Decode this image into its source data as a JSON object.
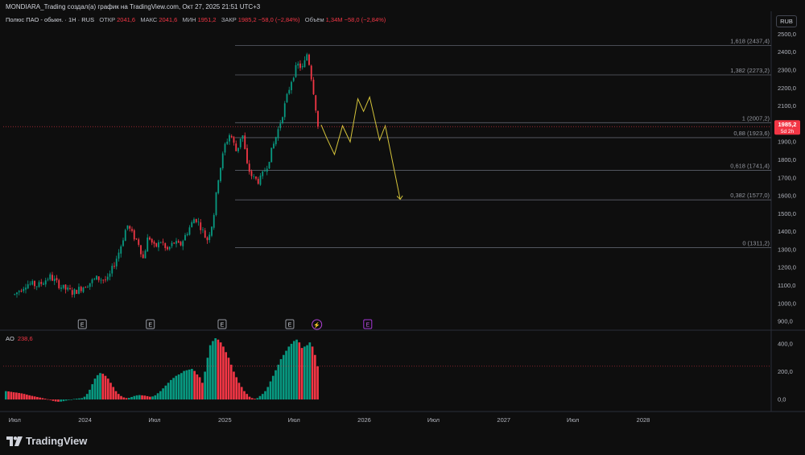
{
  "header": {
    "title": "MONDIARA_Trading создал(а) график на TradingView.com, Окт 27, 2025 21:51 UTC+3"
  },
  "symbol_info": {
    "name": "Полюс ПАО - обыкн. · 1Н · RUS",
    "open_label": "ОТКР",
    "open": "2041,6",
    "high_label": "МАКС",
    "high": "2041,6",
    "low_label": "МИН",
    "low": "1951,2",
    "close_label": "ЗАКР",
    "close": "1985,2",
    "change": "−58,0 (−2,84%)",
    "volume_label": "Объём",
    "volume": "1,34M",
    "volume_change": "−58,0 (−2,84%)"
  },
  "currency_button": "RUB",
  "ao_indicator": {
    "label": "AO",
    "value": "238,6"
  },
  "logo_text": "TradingView",
  "colors": {
    "background": "#0e0e0e",
    "up": "#089981",
    "down": "#f23645",
    "projection": "#d4c33a",
    "fib_line": "#5d606b",
    "price_tag": "#f23645"
  },
  "chart_data": [
    {
      "type": "candlestick",
      "price_axis": [
        "900,0",
        "1000,0",
        "1100,0",
        "1200,0",
        "1300,0",
        "1400,0",
        "1500,0",
        "1600,0",
        "1700,0",
        "1800,0",
        "1900,0",
        "2000,0",
        "2100,0",
        "2200,0",
        "2300,0",
        "2400,0",
        "2500,0"
      ],
      "ylim": [
        860,
        2520
      ],
      "time_axis": [
        "Июл",
        "2024",
        "Июл",
        "2025",
        "Июл",
        "2026",
        "Июл",
        "2027",
        "Июл",
        "2028"
      ],
      "last_price": {
        "value": 1985.2,
        "label": "1985,2",
        "countdown": "5d 2h"
      },
      "price_path": [
        [
          "2023-07-01",
          1050
        ],
        [
          "2023-08-01",
          1110
        ],
        [
          "2023-09-01",
          1100
        ],
        [
          "2023-10-01",
          1150
        ],
        [
          "2023-11-01",
          1090
        ],
        [
          "2023-12-01",
          1060
        ],
        [
          "2024-01-01",
          1100
        ],
        [
          "2024-02-01",
          1140
        ],
        [
          "2024-03-01",
          1130
        ],
        [
          "2024-04-01",
          1300
        ],
        [
          "2024-04-20",
          1440
        ],
        [
          "2024-05-05",
          1380
        ],
        [
          "2024-05-20",
          1340
        ],
        [
          "2024-06-01",
          1250
        ],
        [
          "2024-06-15",
          1380
        ],
        [
          "2024-07-01",
          1310
        ],
        [
          "2024-07-20",
          1350
        ],
        [
          "2024-08-01",
          1290
        ],
        [
          "2024-08-20",
          1340
        ],
        [
          "2024-09-05",
          1320
        ],
        [
          "2024-09-25",
          1400
        ],
        [
          "2024-10-15",
          1480
        ],
        [
          "2024-11-01",
          1420
        ],
        [
          "2024-11-15",
          1350
        ],
        [
          "2024-12-01",
          1460
        ],
        [
          "2024-12-15",
          1700
        ],
        [
          "2025-01-01",
          1880
        ],
        [
          "2025-01-15",
          1950
        ],
        [
          "2025-02-01",
          1840
        ],
        [
          "2025-02-15",
          1960
        ],
        [
          "2025-03-01",
          1760
        ],
        [
          "2025-03-15",
          1700
        ],
        [
          "2025-04-01",
          1680
        ],
        [
          "2025-04-20",
          1760
        ],
        [
          "2025-05-05",
          1860
        ],
        [
          "2025-05-25",
          2000
        ],
        [
          "2025-06-10",
          2130
        ],
        [
          "2025-06-25",
          2250
        ],
        [
          "2025-07-10",
          2330
        ],
        [
          "2025-07-25",
          2310
        ],
        [
          "2025-08-05",
          2400
        ],
        [
          "2025-08-20",
          2200
        ],
        [
          "2025-08-30",
          2040
        ],
        [
          "2025-09-05",
          1985.2
        ]
      ],
      "fibonacci": [
        {
          "label": "1,618 (2437,4)",
          "value": 2437.4
        },
        {
          "label": "1,382 (2273,2)",
          "value": 2273.2
        },
        {
          "label": "1 (2007,2)",
          "value": 2007.2
        },
        {
          "label": "0,88 (1923,6)",
          "value": 1923.6
        },
        {
          "label": "0,618 (1741,4)",
          "value": 1741.4
        },
        {
          "label": "0,382 (1577,0)",
          "value": 1577.0
        },
        {
          "label": "0 (1311,2)",
          "value": 1311.2
        }
      ],
      "projection": [
        [
          "2025-09-10",
          1995
        ],
        [
          "2025-09-25",
          1920
        ],
        [
          "2025-10-15",
          1830
        ],
        [
          "2025-11-05",
          1990
        ],
        [
          "2025-11-25",
          1900
        ],
        [
          "2025-12-15",
          2140
        ],
        [
          "2025-12-30",
          2070
        ],
        [
          "2026-01-15",
          2150
        ],
        [
          "2026-02-10",
          1910
        ],
        [
          "2026-02-25",
          1990
        ],
        [
          "2026-04-05",
          1580
        ]
      ],
      "earnings_markers": [
        {
          "date": "2023-12-25",
          "label": "E"
        },
        {
          "date": "2024-06-20",
          "label": "E"
        },
        {
          "date": "2024-12-25",
          "label": "E"
        },
        {
          "date": "2025-06-20",
          "label": "E"
        },
        {
          "date": "2026-01-10",
          "label": "E"
        }
      ],
      "dividend_marker": {
        "date": "2025-08-30",
        "symbol": "⚡"
      }
    },
    {
      "type": "bar",
      "title": "AO",
      "y_axis": [
        "400,0",
        "200,0",
        "0,0"
      ],
      "ylim": [
        -40,
        440
      ],
      "last_value": 238.6,
      "values": [
        60,
        58,
        55,
        52,
        50,
        47,
        44,
        40,
        35,
        30,
        26,
        22,
        18,
        14,
        10,
        6,
        2,
        -4,
        -10,
        -14,
        -16,
        -15,
        -12,
        -8,
        -4,
        0,
        4,
        6,
        8,
        10,
        20,
        40,
        70,
        110,
        150,
        175,
        190,
        185,
        170,
        150,
        120,
        90,
        60,
        40,
        25,
        15,
        10,
        12,
        18,
        25,
        30,
        32,
        30,
        28,
        24,
        20,
        22,
        30,
        45,
        60,
        80,
        100,
        120,
        140,
        155,
        170,
        180,
        190,
        205,
        210,
        215,
        220,
        205,
        180,
        160,
        120,
        200,
        300,
        390,
        420,
        440,
        430,
        410,
        380,
        340,
        300,
        250,
        200,
        160,
        120,
        90,
        60,
        40,
        20,
        10,
        5,
        10,
        25,
        40,
        60,
        90,
        130,
        170,
        210,
        250,
        290,
        320,
        350,
        380,
        400,
        420,
        430,
        410,
        370,
        380,
        390,
        410,
        380,
        320,
        238.6
      ]
    }
  ]
}
